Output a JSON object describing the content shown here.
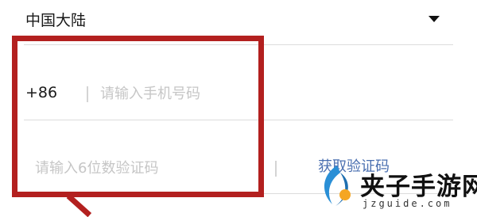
{
  "region": {
    "label": "中国大陆",
    "dropdown_icon": "caret-down-icon"
  },
  "phone": {
    "country_code": "+86",
    "placeholder": "请输入手机号码",
    "value": ""
  },
  "verification": {
    "placeholder": "请输入6位数验证码",
    "value": "",
    "get_code_label": "获取验证码"
  },
  "annotation": {
    "box_color": "#b3201f"
  },
  "watermark": {
    "title": "夹子手游网",
    "domain": "jzguide.com",
    "logo_icon": "jz-logo-icon",
    "logo_colors": [
      "#2a8fd6",
      "#f5a623"
    ]
  },
  "colors": {
    "link": "#4a6fb0",
    "placeholder": "#c6c6c6",
    "divider": "#dcdcdc"
  }
}
